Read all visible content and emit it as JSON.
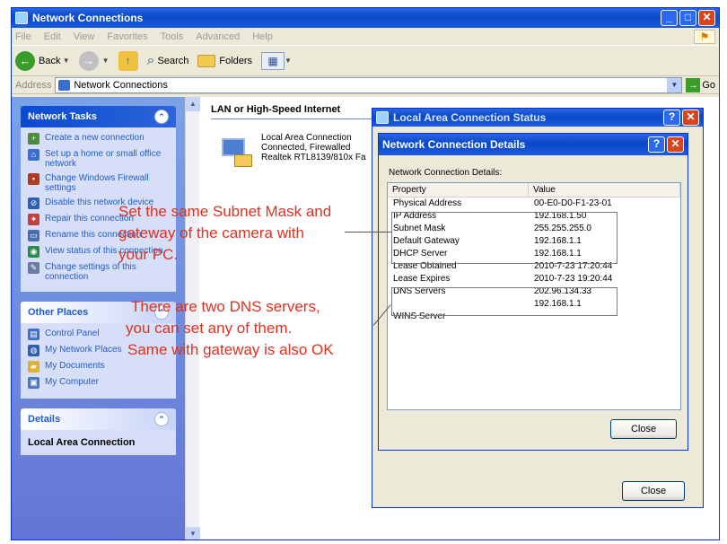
{
  "window": {
    "title": "Network Connections"
  },
  "menu": [
    "File",
    "Edit",
    "View",
    "Favorites",
    "Tools",
    "Advanced",
    "Help"
  ],
  "toolbar": {
    "back": "Back",
    "search": "Search",
    "folders": "Folders"
  },
  "address": {
    "label": "Address",
    "value": "Network Connections",
    "go": "Go"
  },
  "sidebar": {
    "network_tasks": {
      "title": "Network Tasks",
      "items": [
        "Create a new connection",
        "Set up a home or small office network",
        "Change Windows Firewall settings",
        "Disable this network device",
        "Repair this connection",
        "Rename this connection",
        "View status of this connection",
        "Change settings of this connection"
      ]
    },
    "other_places": {
      "title": "Other Places",
      "items": [
        "Control Panel",
        "My Network Places",
        "My Documents",
        "My Computer"
      ]
    },
    "details": {
      "title": "Details",
      "subtitle": "Local Area Connection"
    }
  },
  "files": {
    "group": "LAN or High-Speed Internet",
    "connection": {
      "name": "Local Area Connection",
      "status": "Connected, Firewalled",
      "device": "Realtek RTL8139/810x Fa"
    }
  },
  "status_dialog": {
    "title": "Local Area Connection Status",
    "close": "Close"
  },
  "details_dialog": {
    "title": "Network Connection Details",
    "caption": "Network Connection Details:",
    "columns": [
      "Property",
      "Value"
    ],
    "rows": [
      {
        "property": "Physical Address",
        "value": "00-E0-D0-F1-23-01"
      },
      {
        "property": "IP Address",
        "value": "192.168.1.50"
      },
      {
        "property": "Subnet Mask",
        "value": "255.255.255.0"
      },
      {
        "property": "Default Gateway",
        "value": "192.168.1.1"
      },
      {
        "property": "DHCP Server",
        "value": "192.168.1.1"
      },
      {
        "property": "Lease Obtained",
        "value": "2010-7-23 17:20:44"
      },
      {
        "property": "Lease Expires",
        "value": "2010-7-23 19:20:44"
      },
      {
        "property": "DNS Servers",
        "value": "202.96.134.33"
      },
      {
        "property": "",
        "value": "192.168.1.1"
      },
      {
        "property": "WINS Server",
        "value": ""
      }
    ],
    "close": "Close"
  },
  "annotations": {
    "subnet": [
      "Set the same Subnet Mask and",
      "gateway of the camera with",
      "your PC."
    ],
    "dns": [
      "There are two DNS servers,",
      "you can set any of them.",
      "Same with gateway is also OK"
    ]
  },
  "colors": {
    "annotation": "#e0301e",
    "xp_title": "#0b49c9",
    "task_link": "#215dc6"
  }
}
